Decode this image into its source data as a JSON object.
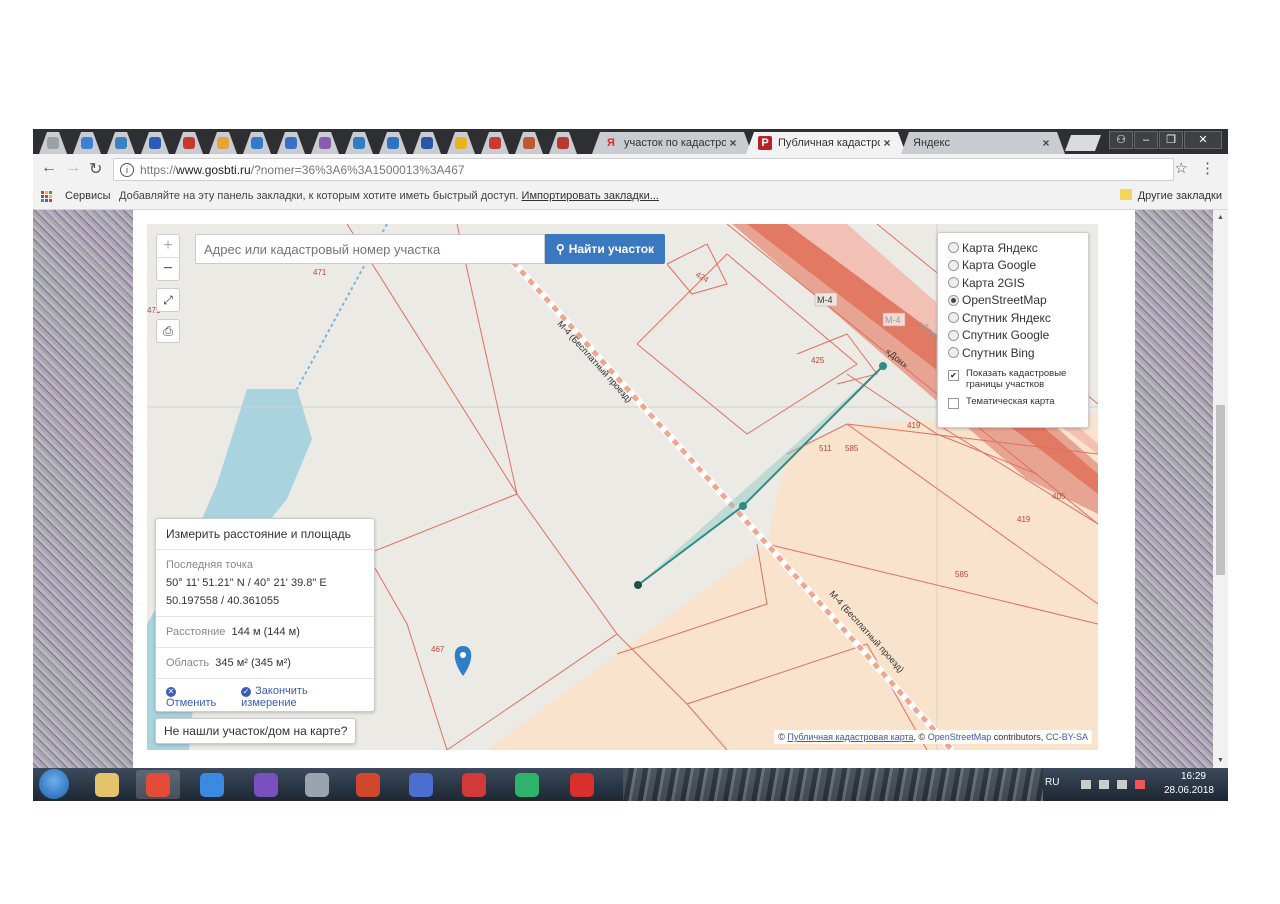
{
  "browser": {
    "pinned_tab_colors": [
      "#9aa0a6",
      "#3f7fd4",
      "#3b82c4",
      "#2a5cb8",
      "#c8382e",
      "#e7a23b",
      "#2e7bd0",
      "#3b6fc4",
      "#8a5bb0",
      "#2f7fbf",
      "#2f73c7",
      "#2a55a8",
      "#e6b325",
      "#c83b2e",
      "#c0582b",
      "#b9392f"
    ],
    "tabs": [
      {
        "title": "участок по кадастров",
        "favicon": "yandex-icon",
        "favicon_char": "Я",
        "favicon_color": "#e02b20"
      },
      {
        "title": "Публичная кадастров",
        "favicon": "rosreestr-icon",
        "favicon_char": "Р",
        "favicon_color": "#b8202a"
      },
      {
        "title": "Яндекс",
        "favicon": "",
        "favicon_char": "",
        "favicon_color": ""
      }
    ],
    "close_glyph": "×",
    "address": {
      "scheme": "https://",
      "host": "www.gosbti.ru",
      "path": "/?nomer=36%3A6%3A1500013%3A467"
    },
    "bookmarks": {
      "services": "Сервисы",
      "hint": "Добавляйте на эту панель закладки, к которым хотите иметь быстрый доступ.",
      "import": "Импортировать закладки...",
      "other": "Другие закладки"
    }
  },
  "map": {
    "search_placeholder": "Адрес или кадастровый номер участка",
    "search_button": "Найти участок",
    "zoom_in": "+",
    "zoom_out": "−",
    "layers": [
      {
        "label": "Карта Яндекс",
        "selected": false
      },
      {
        "label": "Карта Google",
        "selected": false
      },
      {
        "label": "Карта 2GIS",
        "selected": false
      },
      {
        "label": "OpenStreetMap",
        "selected": true
      },
      {
        "label": "Спутник Яндекс",
        "selected": false
      },
      {
        "label": "Спутник Google",
        "selected": false
      },
      {
        "label": "Спутник Bing",
        "selected": false
      }
    ],
    "overlays": [
      {
        "label": "Показать кадастровые границы участков",
        "checked": true
      },
      {
        "label": "Тематическая карта",
        "checked": false
      }
    ],
    "plot_labels": [
      "471",
      "471",
      "424",
      "425",
      "419",
      "511",
      "585",
      "405",
      "419",
      "585",
      "467"
    ],
    "road_labels": [
      "М-4",
      "М-4",
      "М-4 (Бесплатный проезд)",
      "М-4 (Бесплатный проезд)",
      "«Дон»",
      "«Дон»"
    ],
    "measure": {
      "title": "Измерить расстояние и площадь",
      "last_point_label": "Последняя точка",
      "coords_dms": "50° 11' 51.21\" N / 40° 21' 39.8\" E",
      "coords_dec": "50.197558 / 40.361055",
      "distance_label": "Расстояние",
      "distance_value": "144 м (144 м)",
      "area_label": "Область",
      "area_value": "345 м² (345 м²)",
      "cancel": "Отменить",
      "finish": "Закончить измерение"
    },
    "not_found": "Не нашли участок/дом на карте?",
    "attribution": {
      "copy": "©",
      "cadastral": "Публичная кадастровая карта",
      "sep1": ", ©",
      "osm": "OpenStreetMap",
      "contrib": "contributors,",
      "license": "CC-BY-SA"
    }
  },
  "taskbar": {
    "apps": [
      {
        "name": "explorer-icon",
        "color": "#e5c36a"
      },
      {
        "name": "chrome-icon",
        "color": "#e44c3a"
      },
      {
        "name": "ie-icon",
        "color": "#3a8be0"
      },
      {
        "name": "viber-icon",
        "color": "#7a4fc0"
      },
      {
        "name": "scanner-icon",
        "color": "#9aa4ae"
      },
      {
        "name": "ccleaner-icon",
        "color": "#d2462d"
      },
      {
        "name": "network-icon",
        "color": "#4a6fd0"
      },
      {
        "name": "antivirus-icon",
        "color": "#d23a3a"
      },
      {
        "name": "phone-icon",
        "color": "#2fb36a"
      },
      {
        "name": "acrobat-icon",
        "color": "#d8312b"
      }
    ],
    "lang": "RU",
    "time": "16:29",
    "date": "28.06.2018"
  }
}
